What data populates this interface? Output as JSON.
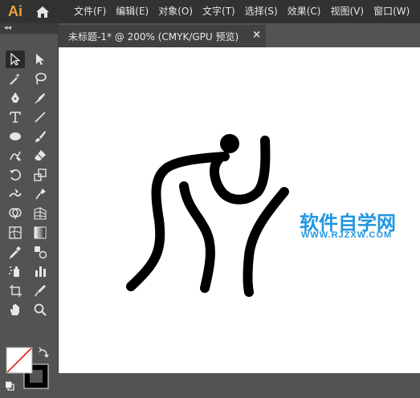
{
  "app": {
    "logo": "Ai"
  },
  "menu": {
    "items": [
      {
        "label": "文件(F)"
      },
      {
        "label": "编辑(E)"
      },
      {
        "label": "对象(O)"
      },
      {
        "label": "文字(T)"
      },
      {
        "label": "选择(S)"
      },
      {
        "label": "效果(C)"
      },
      {
        "label": "视图(V)"
      },
      {
        "label": "窗口(W)"
      }
    ]
  },
  "toolbar": {
    "collapse_label": "◂◂"
  },
  "document": {
    "tab_title": "未标题-1* @ 200% (CMYK/GPU 预览)",
    "close_glyph": "×"
  },
  "watermark": {
    "title": "软件自学网",
    "url": "WWW.RJZXW.COM"
  },
  "colors": {
    "menubar_bg": "#323232",
    "panel_bg": "#535353",
    "logo": "#e8a33d",
    "watermark": "#2196e0",
    "canvas": "#ffffff",
    "artwork": "#000000"
  },
  "tools": [
    "selection-icon",
    "direct-selection-icon",
    "magic-wand-icon",
    "lasso-icon",
    "pen-icon",
    "curvature-icon",
    "type-icon",
    "line-segment-icon",
    "ellipse-icon",
    "paintbrush-icon",
    "shaper-icon",
    "eraser-icon",
    "rotate-icon",
    "scale-icon",
    "warp-icon",
    "puppet-warp-icon",
    "shape-builder-icon",
    "perspective-grid-icon",
    "mesh-icon",
    "gradient-icon",
    "eyedropper-icon",
    "blend-icon",
    "symbol-sprayer-icon",
    "column-graph-icon",
    "artboard-icon",
    "slice-icon",
    "hand-icon",
    "zoom-icon"
  ]
}
